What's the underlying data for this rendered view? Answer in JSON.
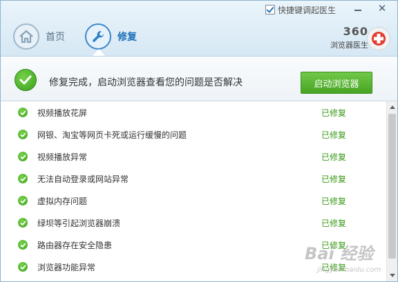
{
  "header": {
    "shortcut_label": "快捷键调起医生",
    "shortcut_checked": true,
    "tabs": [
      {
        "label": "首页",
        "icon": "home-icon"
      },
      {
        "label": "修复",
        "icon": "wrench-icon"
      }
    ],
    "brand": {
      "number": "360",
      "name": "浏览器医生"
    }
  },
  "status": {
    "text": "修复完成，启动浏览器查看您的问题是否解决",
    "button_label": "启动浏览器"
  },
  "items": [
    {
      "label": "视频播放花屏",
      "status": "已修复"
    },
    {
      "label": "网银、淘宝等网页卡死或运行缓慢的问题",
      "status": "已修复"
    },
    {
      "label": "视频播放异常",
      "status": "已修复"
    },
    {
      "label": "无法自动登录或网站异常",
      "status": "已修复"
    },
    {
      "label": "虚拟内存问题",
      "status": "已修复"
    },
    {
      "label": "绿坝等引起浏览器崩溃",
      "status": "已修复"
    },
    {
      "label": "路由器存在安全隐患",
      "status": "已修复"
    },
    {
      "label": "浏览器功能异常",
      "status": "已修复"
    }
  ],
  "watermark": {
    "main": "Bai 经验",
    "sub": "jingyan.baidu.com"
  },
  "colors": {
    "accent": "#1c6fb8",
    "success": "#3a9a17",
    "button": "#47a523"
  }
}
